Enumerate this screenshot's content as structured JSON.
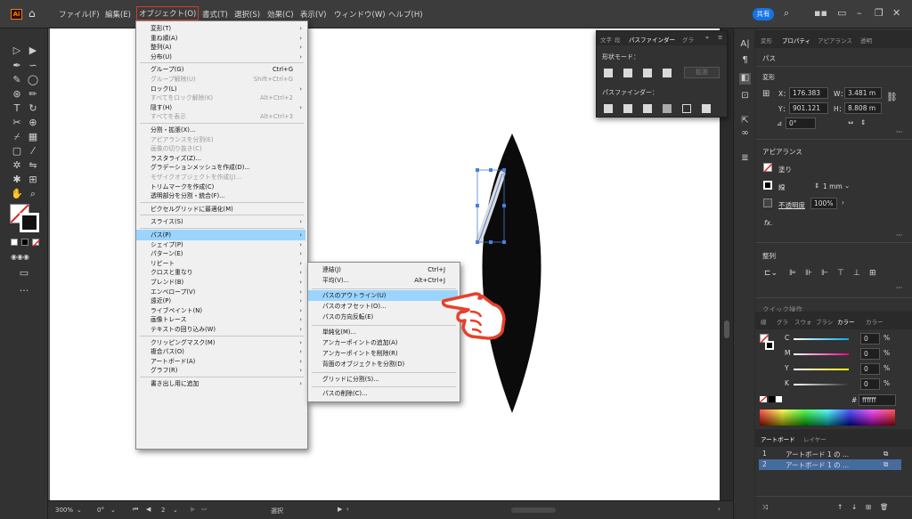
{
  "app": {
    "logo": "Ai"
  },
  "menubar": {
    "items": [
      "ファイル(F)",
      "編集(E)",
      "オブジェクト(O)",
      "書式(T)",
      "選択(S)",
      "効果(C)",
      "表示(V)",
      "ウィンドウ(W)",
      "ヘルプ(H)"
    ],
    "share_label": "共有"
  },
  "object_menu": [
    {
      "label": "変形(T)",
      "arrow": true
    },
    {
      "label": "重ね順(A)",
      "arrow": true
    },
    {
      "label": "整列(A)",
      "arrow": true
    },
    {
      "label": "分布(U)",
      "arrow": true
    },
    {
      "sep": true
    },
    {
      "label": "グループ(G)",
      "shortcut": "Ctrl+G"
    },
    {
      "label": "グループ解除(U)",
      "shortcut": "Shift+Ctrl+G",
      "disabled": true
    },
    {
      "label": "ロック(L)",
      "arrow": true
    },
    {
      "label": "すべてをロック解除(K)",
      "shortcut": "Alt+Ctrl+2",
      "disabled": true
    },
    {
      "label": "隠す(H)",
      "arrow": true
    },
    {
      "label": "すべてを表示",
      "shortcut": "Alt+Ctrl+3",
      "disabled": true
    },
    {
      "sep": true
    },
    {
      "label": "分割・拡張(X)..."
    },
    {
      "label": "アピアランスを分割(E)",
      "disabled": true
    },
    {
      "label": "画像の切り抜き(C)",
      "disabled": true
    },
    {
      "label": "ラスタライズ(Z)..."
    },
    {
      "label": "グラデーションメッシュを作成(D)..."
    },
    {
      "label": "モザイクオブジェクトを作成(J)...",
      "disabled": true
    },
    {
      "label": "トリムマークを作成(C)"
    },
    {
      "label": "透明部分を分割・統合(F)..."
    },
    {
      "sep": true
    },
    {
      "label": "ピクセルグリッドに最適化(M)"
    },
    {
      "sep": true
    },
    {
      "label": "スライス(S)",
      "arrow": true
    },
    {
      "sep": true
    },
    {
      "label": "パス(P)",
      "arrow": true,
      "highlight": true
    },
    {
      "label": "シェイプ(P)",
      "arrow": true
    },
    {
      "label": "パターン(E)",
      "arrow": true
    },
    {
      "label": "リピート",
      "arrow": true
    },
    {
      "label": "クロスと重なり",
      "arrow": true
    },
    {
      "label": "ブレンド(B)",
      "arrow": true
    },
    {
      "label": "エンベロープ(V)",
      "arrow": true
    },
    {
      "label": "遠近(P)",
      "arrow": true
    },
    {
      "label": "ライブペイント(N)",
      "arrow": true
    },
    {
      "label": "画像トレース",
      "arrow": true
    },
    {
      "label": "テキストの回り込み(W)",
      "arrow": true
    },
    {
      "sep": true
    },
    {
      "label": "クリッピングマスク(M)",
      "arrow": true
    },
    {
      "label": "複合パス(O)",
      "arrow": true
    },
    {
      "label": "アートボード(A)",
      "arrow": true
    },
    {
      "label": "グラフ(R)",
      "arrow": true
    },
    {
      "sep": true
    },
    {
      "label": "書き出し用に追加",
      "arrow": true
    }
  ],
  "path_submenu": [
    {
      "label": "連結(J)",
      "shortcut": "Ctrl+J"
    },
    {
      "label": "平均(V)...",
      "shortcut": "Alt+Ctrl+J"
    },
    {
      "sep": true
    },
    {
      "label": "パスのアウトライン(U)",
      "highlight": true
    },
    {
      "label": "パスのオフセット(O)..."
    },
    {
      "label": "パスの方向反転(E)"
    },
    {
      "sep": true
    },
    {
      "label": "単純化(M)..."
    },
    {
      "label": "アンカーポイントの追加(A)"
    },
    {
      "label": "アンカーポイントを削除(R)"
    },
    {
      "label": "背面のオブジェクトを分割(D)"
    },
    {
      "sep": true
    },
    {
      "label": "グリッドに分割(S)..."
    },
    {
      "sep": true
    },
    {
      "label": "パスの削除(C)..."
    }
  ],
  "pathfinder_panel": {
    "tabs": [
      "文字",
      "段",
      "パスファインダー",
      "グラ"
    ],
    "shape_mode_label": "形状モード：",
    "expand_label": "拡張",
    "pathfinder_label": "パスファインダー："
  },
  "properties_panel": {
    "tabs": [
      "変形",
      "プロパティ",
      "アピアランス",
      "透明"
    ],
    "selection_type": "パス",
    "transform_label": "変形",
    "x_label": "X：",
    "x_value": "176.383",
    "w_label": "W：",
    "w_value": "3.481 m",
    "y_label": "Y：",
    "y_value": "901.121",
    "h_label": "H：",
    "h_value": "8.808 m",
    "angle_value": "0°",
    "appearance_label": "アピアランス",
    "fill_label": "塗り",
    "stroke_label": "線",
    "stroke_value": "1 mm",
    "opacity_label": "不透明度",
    "opacity_value": "100%",
    "fx_label": "fx.",
    "align_label": "整列",
    "quick_actions_label": "クイック操作"
  },
  "color_panel": {
    "tabs": [
      "線",
      "グラ",
      "スウォ",
      "ブラシ",
      "カラー",
      "カラー"
    ],
    "channels": [
      {
        "name": "C",
        "value": "0",
        "unit": "%",
        "color": "#00aeef"
      },
      {
        "name": "M",
        "value": "0",
        "unit": "%",
        "color": "#ec008c"
      },
      {
        "name": "Y",
        "value": "0",
        "unit": "%",
        "color": "#fff200"
      },
      {
        "name": "K",
        "value": "0",
        "unit": "%",
        "color": "#333333"
      }
    ],
    "hex_label": "#",
    "hex_value": "ffffff"
  },
  "artboards_panel": {
    "tabs": [
      "アートボード",
      "レイヤー"
    ],
    "rows": [
      {
        "num": "1",
        "name": "アートボード 1 の ..."
      },
      {
        "num": "2",
        "name": "アートボード 1 の ..."
      }
    ]
  },
  "statusbar": {
    "zoom": "300%",
    "angle": "0°",
    "artboard_num": "2",
    "tool_label": "選択"
  },
  "colors": {
    "object_menu_outline": "#d93a2b",
    "menu_highlight": "#9bd4ff",
    "share_button": "#1473e6",
    "hand_cursor": "#e8402a"
  }
}
